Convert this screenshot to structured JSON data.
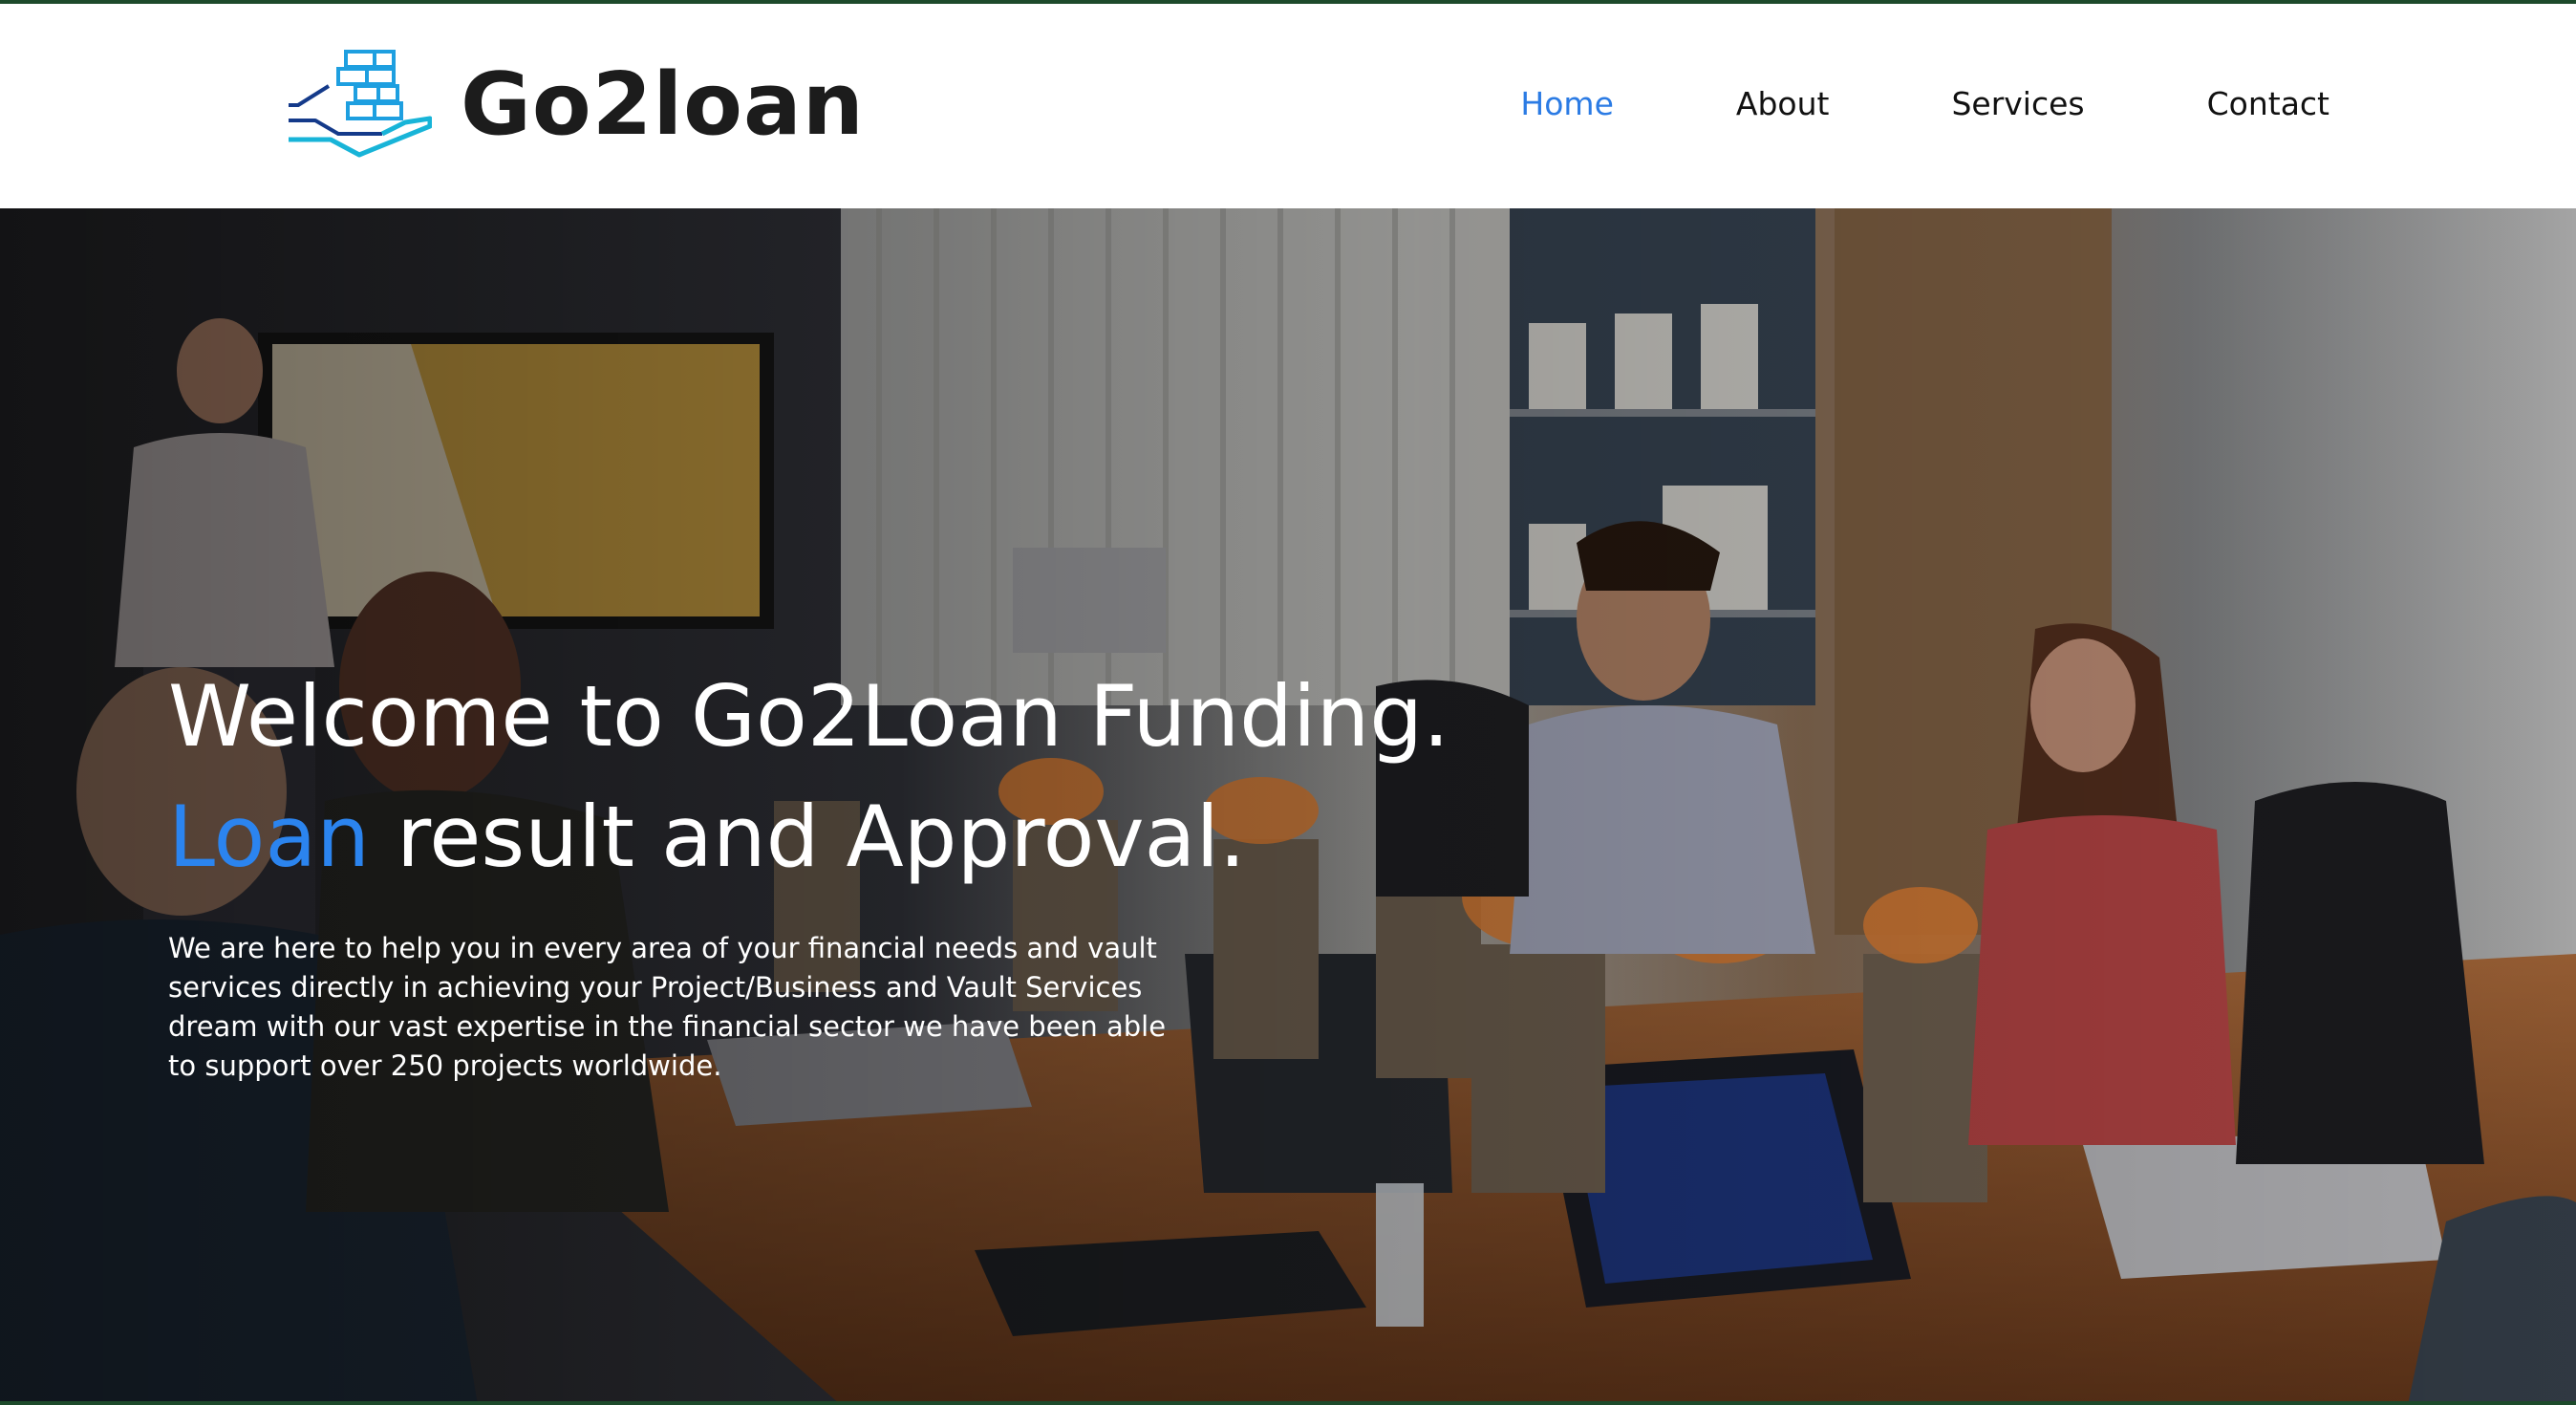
{
  "header": {
    "logo_text": "Go2loan",
    "nav": [
      {
        "label": "Home",
        "active": true
      },
      {
        "label": "About",
        "active": false
      },
      {
        "label": "Services",
        "active": false
      },
      {
        "label": "Contact",
        "active": false
      }
    ]
  },
  "hero": {
    "headline_line1": "Welcome to Go2Loan Funding.",
    "headline_line2_accent": "Loan",
    "headline_line2_rest": " result and Approval.",
    "body": "We are here to help you in every area of your financial needs and vault services directly in achieving your Project/Business and Vault Services dream with our vast expertise in the financial sector we have been able to support over 250 projects worldwide."
  },
  "colors": {
    "accent": "#2b84ef",
    "nav_active": "#2b7be4",
    "top_border": "#1d4a2b",
    "logo_mark": "#1ea0e0"
  },
  "icons": {
    "logo_mark": "stacked-coins-hand-icon"
  }
}
